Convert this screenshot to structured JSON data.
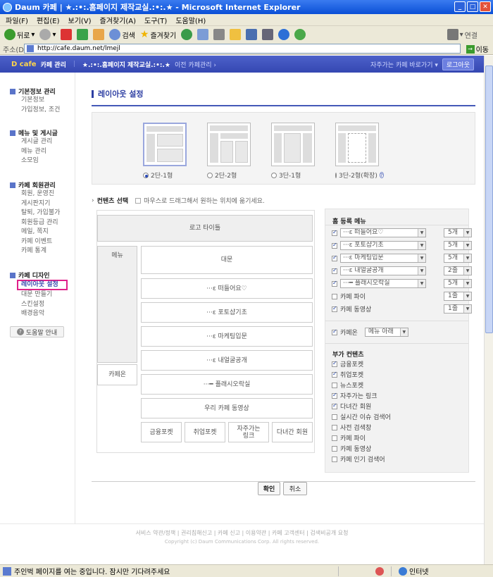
{
  "window": {
    "title": "Daum 카페 | ★.:•:.홈페이지 제작교실.:•:.★ - Microsoft Internet Explorer"
  },
  "menu": [
    "파일(F)",
    "편집(E)",
    "보기(V)",
    "즐겨찾기(A)",
    "도구(T)",
    "도움말(H)"
  ],
  "toolbar": {
    "back": "뒤로",
    "search": "검색",
    "favorites": "즐겨찾기",
    "links": "연결"
  },
  "address": {
    "label": "주소(D)",
    "url": "http://cafe.daum.net/lmejl",
    "go": "이동"
  },
  "cafebar": {
    "logo": "D cafe",
    "mgmt": "카페 관리",
    "name": "★.:•:.홈페이지 제작교실.:•:.★",
    "prev": "이전 카페관리 ›",
    "shortcut": "자주가는 카페 바로가기 ▾",
    "login": "로그아웃"
  },
  "sidebar": {
    "groups": [
      {
        "title": "기본정보 관리",
        "items": [
          "기본정보",
          "가입정보, 조건"
        ]
      },
      {
        "title": "메뉴 및 게시글",
        "items": [
          "게시글 관리",
          "메뉴 관리",
          "소모임"
        ]
      },
      {
        "title": "카페 회원관리",
        "items": [
          "회원, 운영진",
          "게시판지기",
          "탈퇴, 가입불가",
          "회원등급 관리",
          "메일, 쪽지",
          "카페 이벤트",
          "카페 통계"
        ]
      },
      {
        "title": "카페 디자인",
        "items": [
          "레이아웃 설정",
          "대문 만들기",
          "스킨설정",
          "배경음악"
        ]
      }
    ],
    "help": "도움말 안내"
  },
  "main": {
    "title": "레이아웃 설정",
    "layouts": [
      {
        "label": "2단-1형",
        "selected": true
      },
      {
        "label": "2단-2형",
        "selected": false
      },
      {
        "label": "3단-1형",
        "selected": false
      },
      {
        "label": "3단-2형(확장)",
        "selected": false
      }
    ],
    "content_select": {
      "title": "컨텐츠 선택",
      "hint": "마우스로 드래그해서 원하는 위치에 옮기세요."
    },
    "preview": {
      "logo": "로고 타이틀",
      "menu": "메뉴",
      "cafeon": "카페온",
      "gate": "대문",
      "boards": [
        "···ε 떠들어요♡",
        "···ε 포토샵기초",
        "···ε 마케팅입문",
        "···ε 내얼굴공개",
        "···━ 플래시오락실"
      ],
      "video": "우리 카페 동영상",
      "bottom": [
        "금융포켓",
        "취업포켓",
        "자주가는\n링크",
        "다녀간 회원"
      ]
    },
    "right": {
      "home_menu_title": "홈 등록 메뉴",
      "home_menu": [
        {
          "label": "···ε 떠들어요♡",
          "count": "5개",
          "checked": true
        },
        {
          "label": "···ε 포토샵기초",
          "count": "5개",
          "checked": true
        },
        {
          "label": "···ε 마케팅입문",
          "count": "5개",
          "checked": true
        },
        {
          "label": "···ε 내얼굴공개",
          "count": "2줄",
          "checked": true
        },
        {
          "label": "···━ 플래시오락실",
          "count": "5개",
          "checked": true
        }
      ],
      "extras": [
        {
          "label": "카페 파이",
          "count": "1줄",
          "checked": false
        },
        {
          "label": "카페 동영상",
          "count": "1줄",
          "checked": true
        }
      ],
      "cafeon": {
        "label": "카페온",
        "value": "메뉴 아래",
        "checked": true
      },
      "addon_title": "부가 컨텐츠",
      "addons": [
        {
          "label": "금융포켓",
          "checked": true
        },
        {
          "label": "취업포켓",
          "checked": true
        },
        {
          "label": "뉴스포켓",
          "checked": false
        },
        {
          "label": "자주가는 링크",
          "checked": true
        },
        {
          "label": "다녀간 회원",
          "checked": true
        },
        {
          "label": "실시간 이슈 검색어",
          "checked": false
        },
        {
          "label": "사전 검색창",
          "checked": false
        },
        {
          "label": "카페 파이",
          "checked": false
        },
        {
          "label": "카페 동영상",
          "checked": false
        },
        {
          "label": "카페 인기 검색어",
          "checked": false
        }
      ]
    },
    "buttons": {
      "ok": "확인",
      "cancel": "취소"
    }
  },
  "footer": {
    "links": "서비스 약관/정책 | 권리침해신고 | 카페 신고 | 이용약관 | 카페 고객센터 | 검색비공개 요청",
    "copyright": "Copyright (c) Daum Communications Corp. All rights reserved."
  },
  "status": {
    "text": "주인벅 페이지를 여는 중입니다. 잠시만 기다려주세요",
    "zone": "인터넷"
  }
}
